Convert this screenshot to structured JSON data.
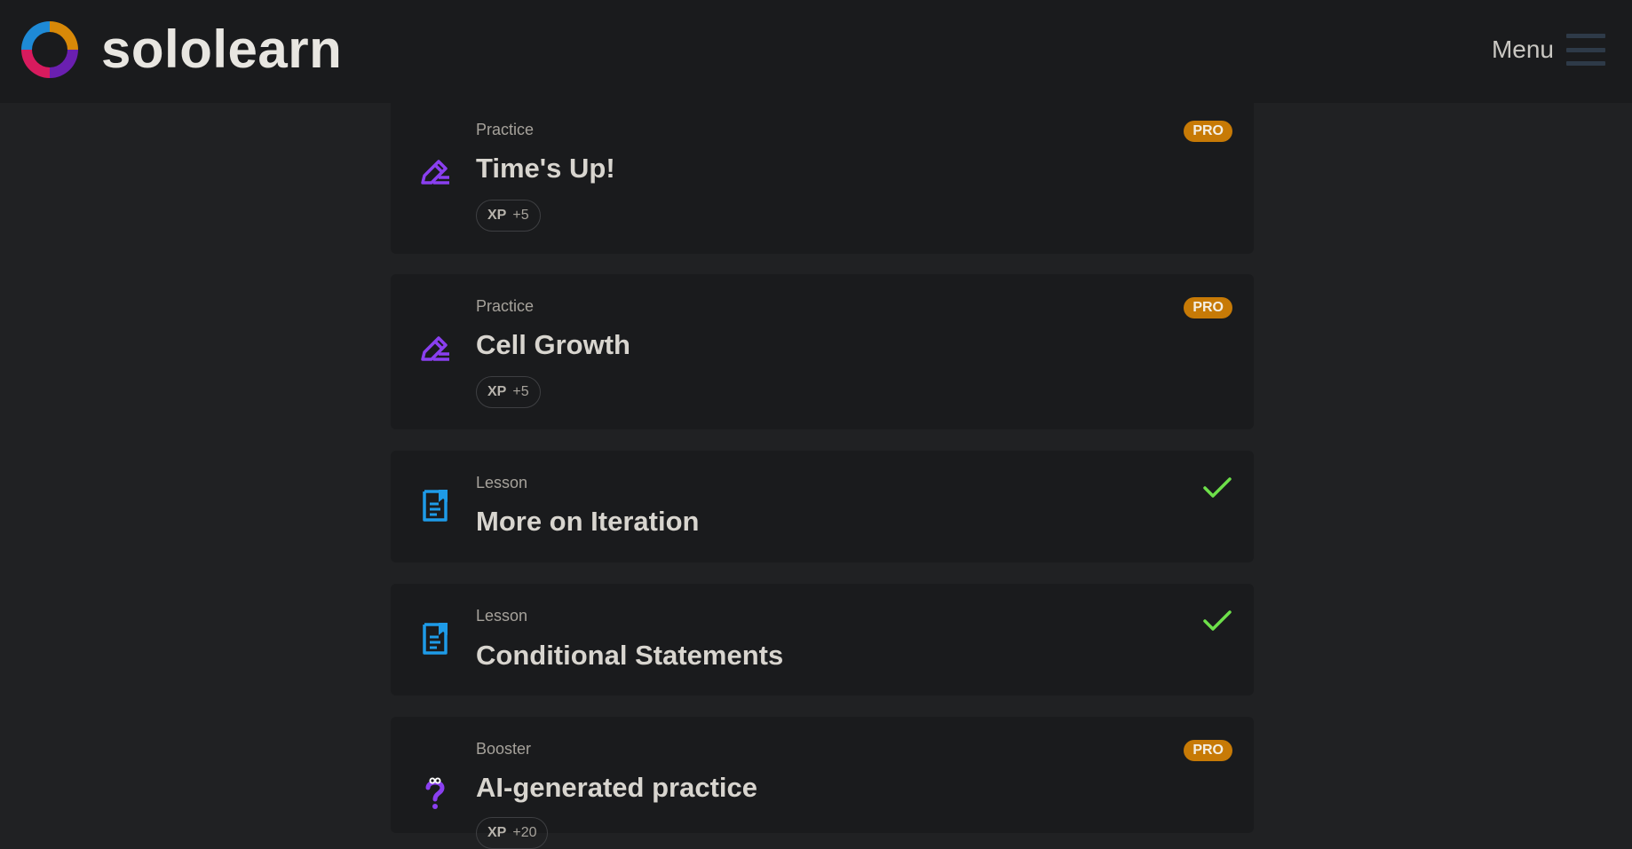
{
  "header": {
    "brand": "sololearn",
    "menu_label": "Menu"
  },
  "colors": {
    "pro_badge": "#c77a06",
    "practice_icon": "#8a3ff0",
    "lesson_icon": "#1e9be8",
    "check": "#6de04a"
  },
  "cards": [
    {
      "type": "Practice",
      "title": "Time's Up!",
      "xp_label": "XP",
      "xp_value": "+5",
      "badge": "PRO",
      "icon": "pencil-edit-icon"
    },
    {
      "type": "Practice",
      "title": "Cell Growth",
      "xp_label": "XP",
      "xp_value": "+5",
      "badge": "PRO",
      "icon": "pencil-edit-icon"
    },
    {
      "type": "Lesson",
      "title": "More on Iteration",
      "status": "completed",
      "icon": "lesson-document-icon"
    },
    {
      "type": "Lesson",
      "title": "Conditional Statements",
      "status": "completed",
      "icon": "lesson-document-icon"
    },
    {
      "type": "Booster",
      "title": "AI-generated practice",
      "xp_label": "XP",
      "xp_value": "+20",
      "badge": "PRO",
      "icon": "question-mark-icon"
    }
  ]
}
